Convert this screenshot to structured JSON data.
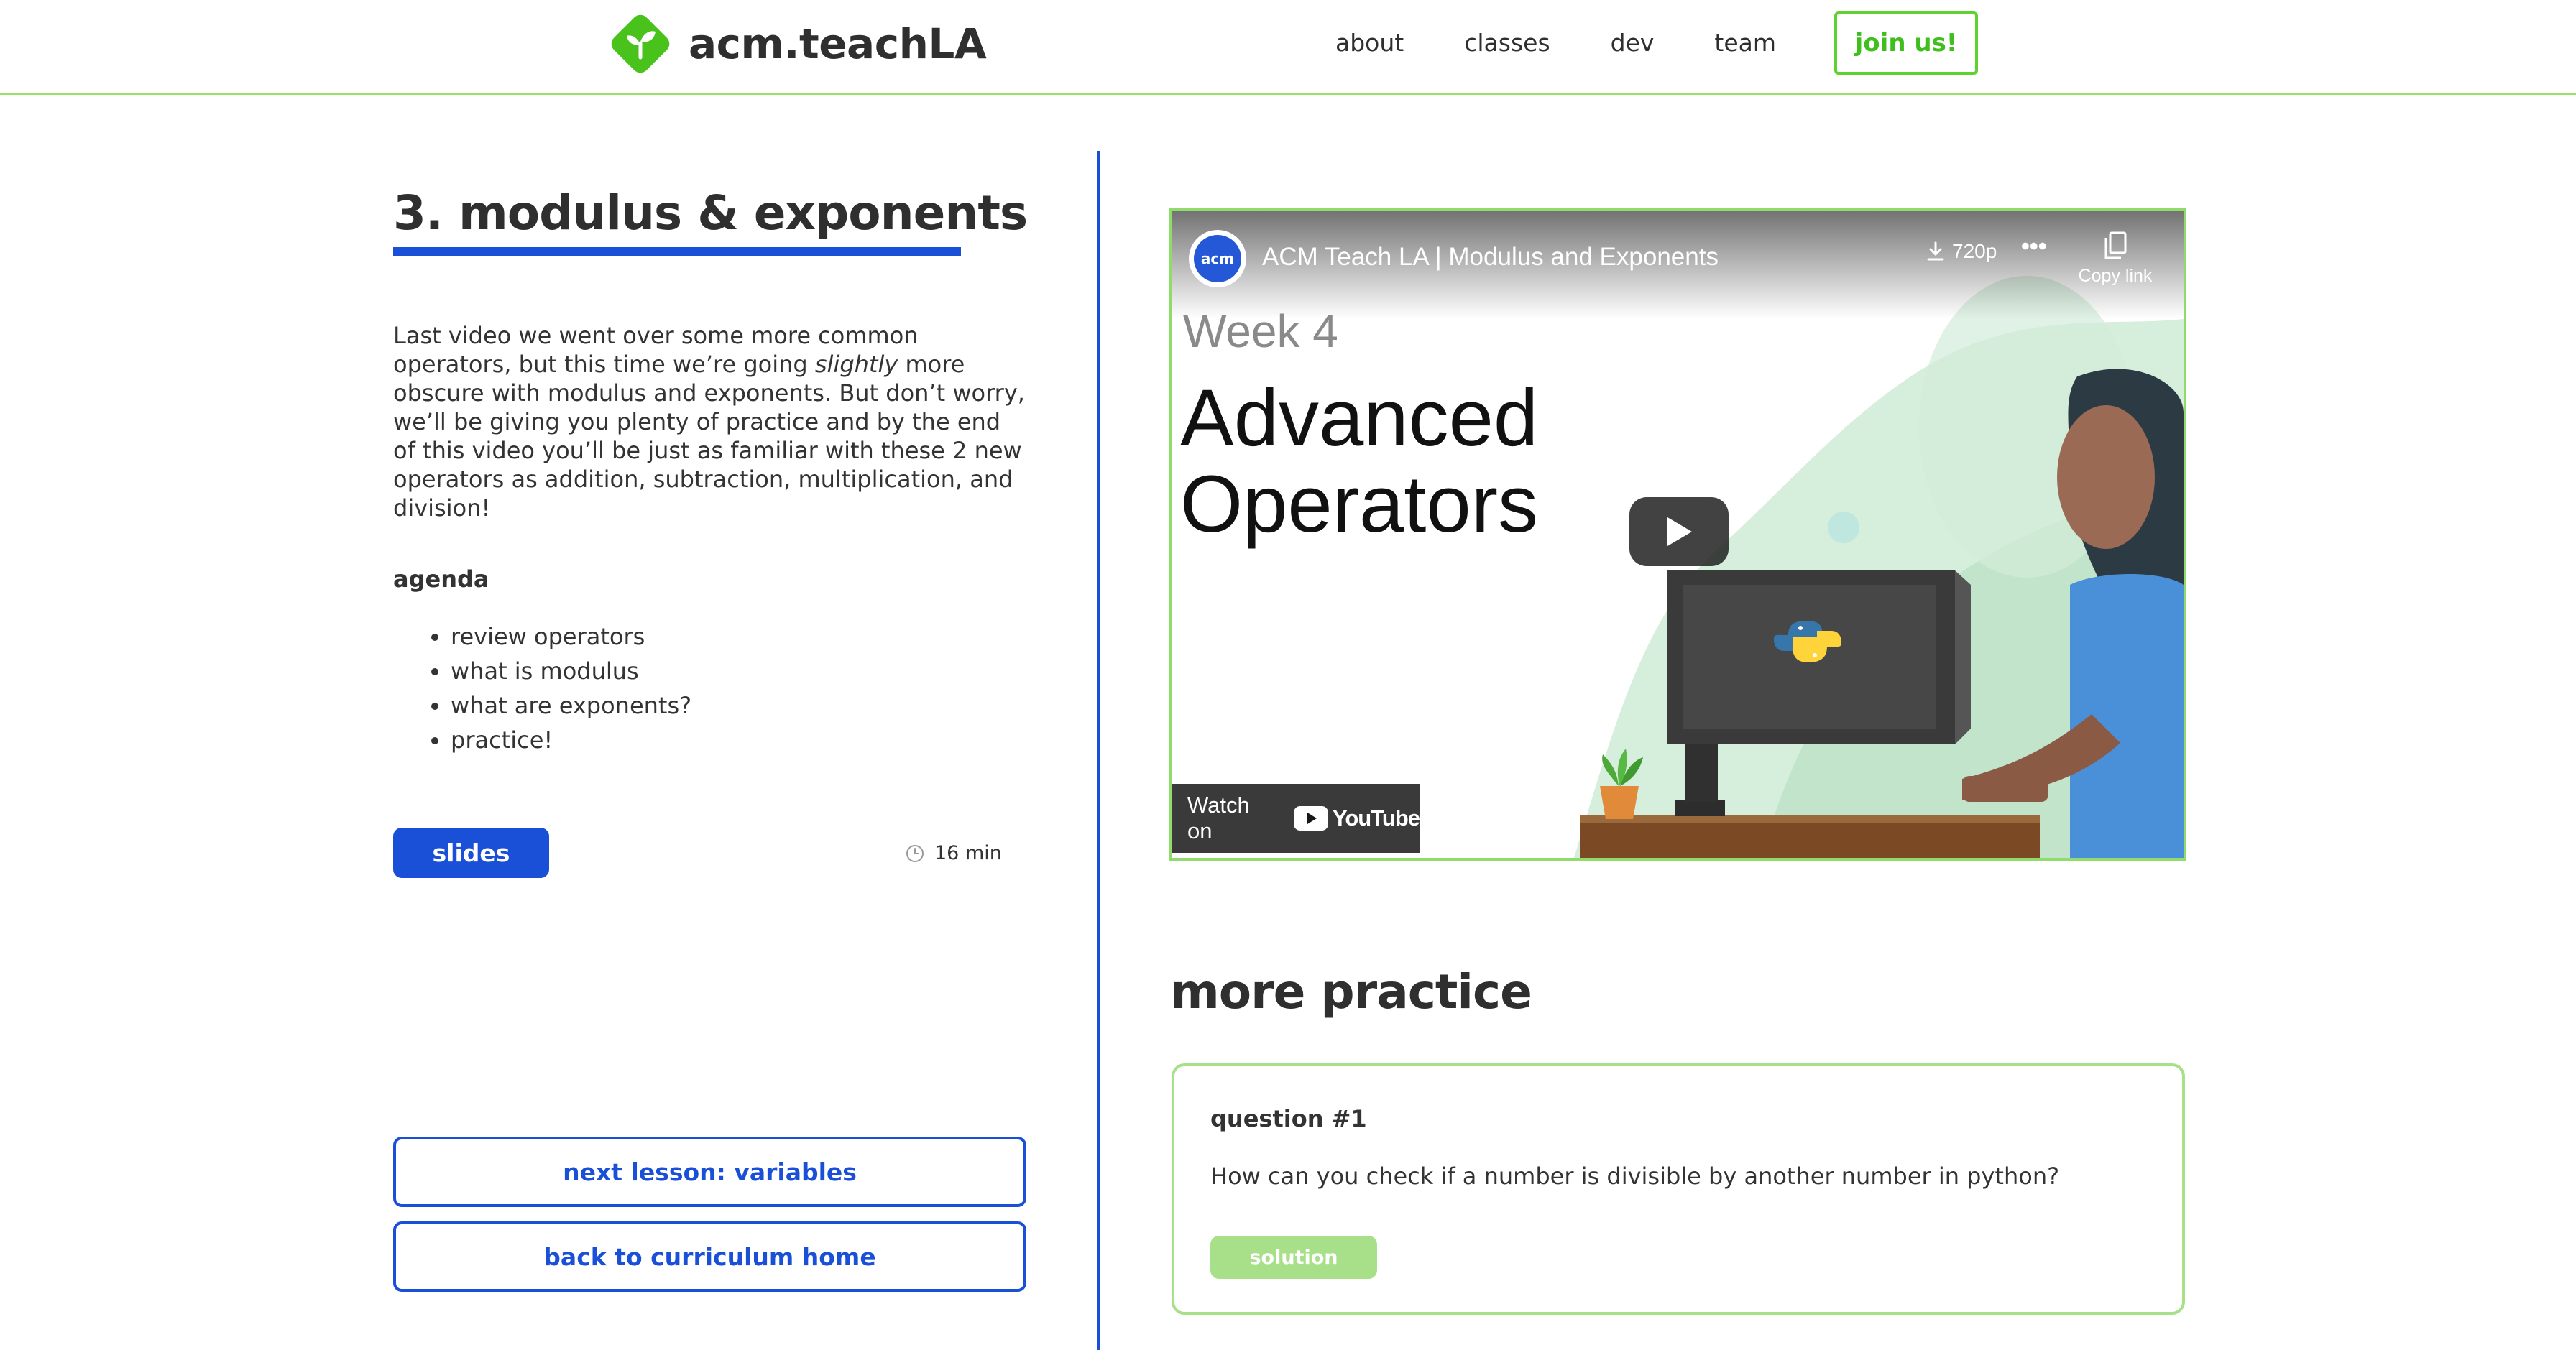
{
  "header": {
    "logo_text": "acm.teachLA",
    "nav": [
      {
        "label": "about"
      },
      {
        "label": "classes"
      },
      {
        "label": "dev"
      },
      {
        "label": "team"
      }
    ],
    "cta_label": "join us!",
    "accent_color": "#5ed330"
  },
  "lesson": {
    "title": "3. modulus & exponents",
    "description_parts": {
      "before": "Last video we went over some more common operators, but this time we’re going ",
      "emphasis": "slightly",
      "after": " more obscure with modulus and exponents. But don’t worry, we’ll be giving you plenty of practice and by the end of this video you’ll be just as familiar with these 2 new operators as addition, subtraction, multiplication, and division!"
    },
    "agenda_heading": "agenda",
    "agenda": [
      "review operators",
      "what is modulus",
      "what are exponents?",
      "practice!"
    ],
    "slides_label": "slides",
    "duration": "16 min",
    "next_label": "next lesson: variables",
    "back_label": "back to curriculum home",
    "primary_color": "#1a4fd8"
  },
  "video": {
    "channel_avatar_text": "acm",
    "title": "ACM Teach LA | Modulus and Exponents",
    "quality": "720p",
    "copy_link_label": "Copy link",
    "slide_week": "Week 4",
    "slide_heading_line1": "Advanced",
    "slide_heading_line2": "Operators",
    "watch_on_label": "Watch on",
    "youtube_label": "YouTube",
    "icons": [
      "download-icon",
      "more-icon",
      "copy-icon",
      "play-icon",
      "youtube-logo-icon"
    ]
  },
  "practice": {
    "heading": "more practice",
    "questions": [
      {
        "label": "question #1",
        "text": "How can you check if a number is divisible by another number in python?",
        "solution_label": "solution"
      }
    ]
  }
}
